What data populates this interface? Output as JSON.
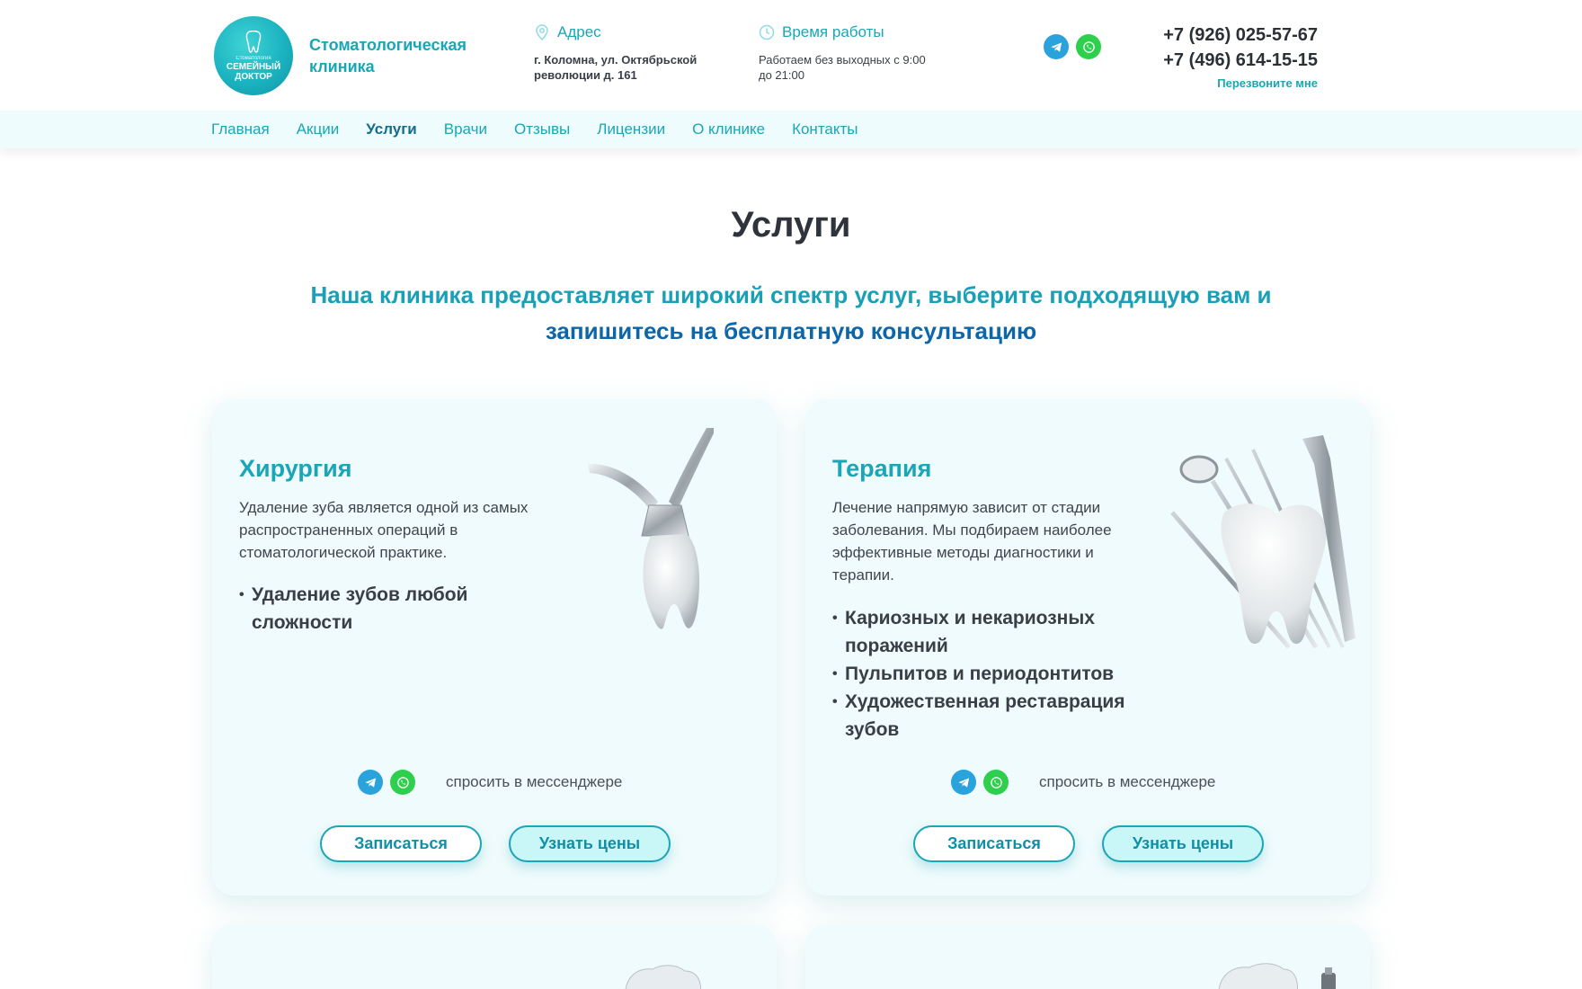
{
  "header": {
    "logo": {
      "small": "Стоматология",
      "line1": "СЕМЕЙНЫЙ",
      "line2": "ДОКТОР"
    },
    "clinic_name": "Стоматологическая клиника",
    "address": {
      "title": "Адрес",
      "text": "г. Коломна, ул. Октябрьской революции д. 161"
    },
    "hours": {
      "title": "Время работы",
      "text": "Работаем без выходных с 9:00 до 21:00"
    },
    "phones": [
      "+7 (926) 025-57-67",
      "+7 (496) 614-15-15"
    ],
    "callback": "Перезвоните мне"
  },
  "nav": {
    "items": [
      "Главная",
      "Акции",
      "Услуги",
      "Врачи",
      "Отзывы",
      "Лицензии",
      "О клинике",
      "Контакты"
    ],
    "active": "Услуги"
  },
  "main": {
    "title": "Услуги",
    "subtitle_part1": "Наша клиника предоставляет широкий спектр услуг, выберите подходящую вам и ",
    "subtitle_accent": "запишитесь на бесплатную консультацию"
  },
  "cards": [
    {
      "title": "Хирургия",
      "description": "Удаление зуба является одной из самых распространенных операций в стоматологической практике.",
      "bullets": [
        "Удаление зубов любой сложности"
      ],
      "ask_messenger": "спросить в мессенджере",
      "btn_signup": "Записаться",
      "btn_prices": "Узнать цены"
    },
    {
      "title": "Терапия",
      "description": "Лечение напрямую зависит от стадии заболевания. Мы подбираем наиболее эффективные методы диагностики и терапии.",
      "bullets": [
        "Кариозных и некариозных поражений",
        "Пульпитов и периодонтитов",
        "Художественная реставрация зубов"
      ],
      "ask_messenger": "спросить в мессенджере",
      "btn_signup": "Записаться",
      "btn_prices": "Узнать цены"
    }
  ],
  "colors": {
    "brand": "#1aa6b7",
    "accent": "#0c66a8",
    "card_bg": "#effbfc",
    "nav_bg": "#effcfd"
  },
  "icons": [
    "map-pin-icon",
    "clock-icon",
    "telegram-icon",
    "whatsapp-icon",
    "tooth-icon"
  ]
}
